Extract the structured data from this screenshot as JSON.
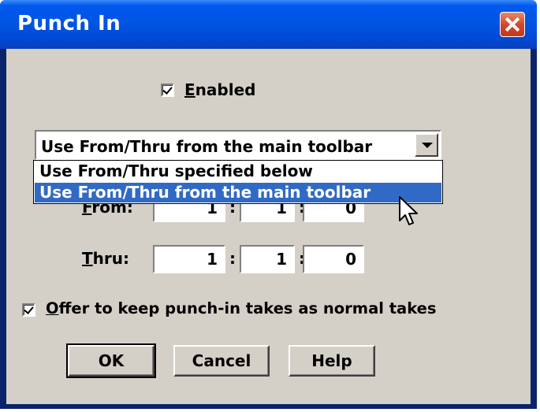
{
  "window": {
    "title": "Punch In"
  },
  "enabled": {
    "checked": true,
    "mnemonic": "E",
    "rest": "nabled"
  },
  "combo": {
    "selected": "Use From/Thru from the main toolbar"
  },
  "dropdown": {
    "options": [
      "Use From/Thru specified below",
      "Use From/Thru from the main toolbar"
    ],
    "selected_index": 1
  },
  "from": {
    "mnemonic": "F",
    "rest": "rom:",
    "values": [
      "1",
      "1",
      "0"
    ]
  },
  "thru": {
    "mnemonic": "T",
    "rest": "hru:",
    "values": [
      "1",
      "1",
      "0"
    ]
  },
  "offer": {
    "checked": true,
    "mnemonic": "O",
    "rest": "ffer to keep punch-in takes as normal takes"
  },
  "buttons": {
    "ok": "OK",
    "cancel": "Cancel",
    "help": "Help"
  },
  "colors": {
    "titlebar": "#0055e3",
    "face": "#d4d0c8",
    "selection": "#316ac5",
    "close": "#d1442a"
  },
  "icons": {
    "close": "close-icon",
    "dropdown": "chevron-down-icon",
    "cursor": "mouse-pointer-icon"
  }
}
